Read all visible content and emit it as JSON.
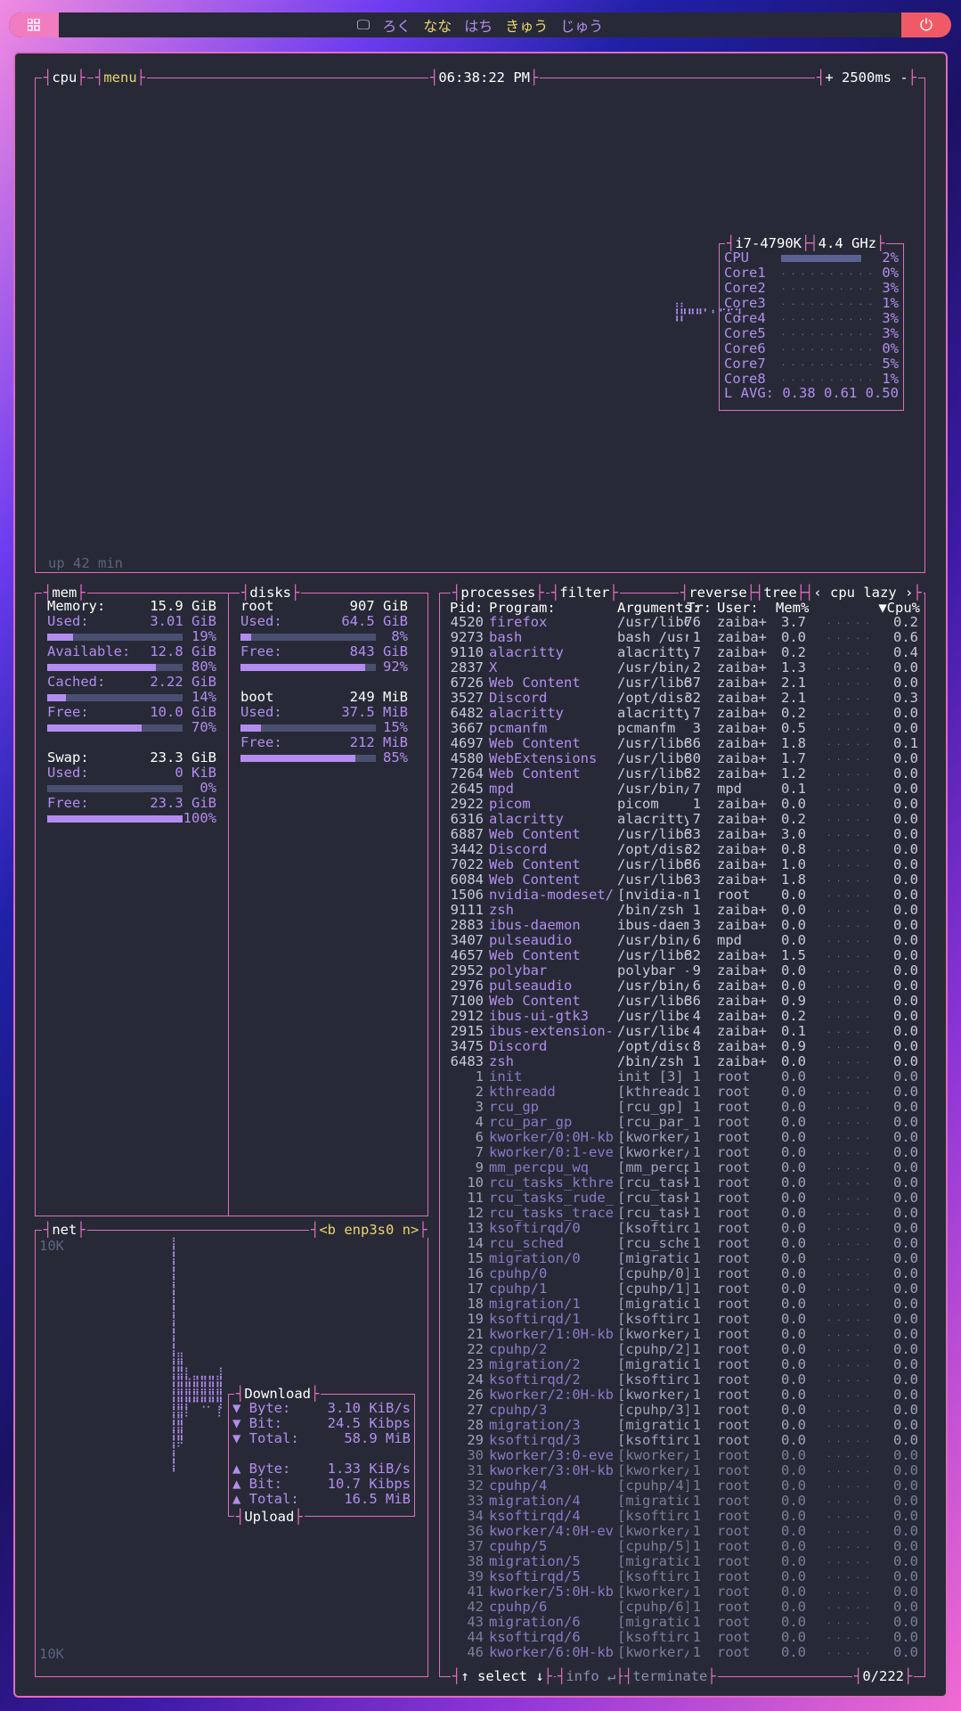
{
  "bar": {
    "workspaces": [
      "ろく",
      "なな",
      "はち",
      "きゅう",
      "じゅう"
    ],
    "active": [
      "なな",
      "きゅう"
    ]
  },
  "cpu": {
    "tab": "cpu",
    "menu": "menu",
    "clock": "06:38:22 PM",
    "refresh": "+ 2500ms -",
    "uptime": "up 42 min",
    "model": "i7-4790K",
    "freq": "4.4 GHz",
    "cores": [
      {
        "label": "CPU",
        "pct": "2%",
        "value": 2
      },
      {
        "label": "Core1",
        "pct": "0%",
        "value": 0
      },
      {
        "label": "Core2",
        "pct": "3%",
        "value": 3
      },
      {
        "label": "Core3",
        "pct": "1%",
        "value": 1
      },
      {
        "label": "Core4",
        "pct": "3%",
        "value": 3
      },
      {
        "label": "Core5",
        "pct": "3%",
        "value": 3
      },
      {
        "label": "Core6",
        "pct": "0%",
        "value": 0
      },
      {
        "label": "Core7",
        "pct": "5%",
        "value": 5
      },
      {
        "label": "Core8",
        "pct": "1%",
        "value": 1
      }
    ],
    "lavg": "L AVG: 0.38 0.61 0.50"
  },
  "mem": {
    "title": "mem",
    "rows": [
      {
        "label": "Memory:",
        "value": "15.9 GiB"
      },
      {
        "label": "Used:",
        "value": "3.01 GiB",
        "pct": "19%",
        "fill": 19
      },
      {
        "label": "Available:",
        "value": "12.8 GiB",
        "pct": "80%",
        "fill": 80
      },
      {
        "label": "Cached:",
        "value": "2.22 GiB",
        "pct": "14%",
        "fill": 14
      },
      {
        "label": "Free:",
        "value": "10.0 GiB",
        "pct": "70%",
        "fill": 70
      },
      {
        "label": "Swap:",
        "value": "23.3 GiB"
      },
      {
        "label": "Used:",
        "value": "0 KiB",
        "pct": "0%",
        "fill": 0
      },
      {
        "label": "Free:",
        "value": "23.3 GiB",
        "pct": "100%",
        "fill": 100
      }
    ]
  },
  "disks": {
    "title": "disks",
    "list": [
      {
        "name": "root",
        "size": "907 GiB",
        "used": "64.5 GiB",
        "used_pct": "8%",
        "used_fill": 8,
        "free": "843 GiB",
        "free_pct": "92%",
        "free_fill": 92
      },
      {
        "name": "boot",
        "size": "249 MiB",
        "used": "37.5 MiB",
        "used_pct": "15%",
        "used_fill": 15,
        "free": "212 MiB",
        "free_pct": "85%",
        "free_fill": 85
      }
    ],
    "used_label": "Used:",
    "free_label": "Free:"
  },
  "net": {
    "title": "net",
    "iface": "<b enp3s0 n>",
    "top_scale": "10K",
    "bottom_scale": "10K",
    "download": {
      "title": "Download",
      "byte": "3.10 KiB/s",
      "bit": "24.5 Kibps",
      "total": "58.9 MiB"
    },
    "upload": {
      "title": "Upload",
      "byte": "1.33 KiB/s",
      "bit": "10.7 Kibps",
      "total": "16.5 MiB"
    },
    "labels": {
      "byte": "Byte:",
      "bit": "Bit:",
      "total": "Total:"
    }
  },
  "proc": {
    "title": "processes",
    "filter": "filter",
    "reverse": "reverse",
    "tree": "tree",
    "sort": "‹ cpu lazy ›",
    "headers": {
      "pid": "Pid:",
      "program": "Program:",
      "args": "Arguments:",
      "threads": "Tr:",
      "user": "User:",
      "mem": "Mem%",
      "cpu": "▼Cpu%"
    },
    "footer": {
      "select": "↑ select ↓",
      "info": "info ↵",
      "terminate": "terminate",
      "count": "0/222"
    },
    "rows": [
      [
        "4520",
        "firefox",
        "/usr/lib6",
        "76",
        "zaiba+",
        "3.7",
        "0.2"
      ],
      [
        "9273",
        "bash",
        "bash /usr",
        "1",
        "zaiba+",
        "0.0",
        "0.6"
      ],
      [
        "9110",
        "alacritty",
        "alacritty",
        "7",
        "zaiba+",
        "0.2",
        "0.4"
      ],
      [
        "2837",
        "X",
        "/usr/bin/",
        "2",
        "zaiba+",
        "1.3",
        "0.0"
      ],
      [
        "6726",
        "Web Content",
        "/usr/lib6",
        "37",
        "zaiba+",
        "2.1",
        "0.0"
      ],
      [
        "3527",
        "Discord",
        "/opt/disc",
        "32",
        "zaiba+",
        "2.1",
        "0.3"
      ],
      [
        "6482",
        "alacritty",
        "alacritty",
        "7",
        "zaiba+",
        "0.2",
        "0.0"
      ],
      [
        "3667",
        "pcmanfm",
        "pcmanfm",
        "3",
        "zaiba+",
        "0.5",
        "0.0"
      ],
      [
        "4697",
        "Web Content",
        "/usr/lib6",
        "36",
        "zaiba+",
        "1.8",
        "0.1"
      ],
      [
        "4580",
        "WebExtensions",
        "/usr/lib6",
        "30",
        "zaiba+",
        "1.7",
        "0.0"
      ],
      [
        "7264",
        "Web Content",
        "/usr/lib6",
        "32",
        "zaiba+",
        "1.2",
        "0.0"
      ],
      [
        "2645",
        "mpd",
        "/usr/bin/",
        "7",
        "mpd",
        "0.1",
        "0.0"
      ],
      [
        "2922",
        "picom",
        "picom",
        "1",
        "zaiba+",
        "0.0",
        "0.0"
      ],
      [
        "6316",
        "alacritty",
        "alacritty",
        "7",
        "zaiba+",
        "0.2",
        "0.0"
      ],
      [
        "6887",
        "Web Content",
        "/usr/lib6",
        "33",
        "zaiba+",
        "3.0",
        "0.0"
      ],
      [
        "3442",
        "Discord",
        "/opt/disc",
        "32",
        "zaiba+",
        "0.8",
        "0.0"
      ],
      [
        "7022",
        "Web Content",
        "/usr/lib6",
        "36",
        "zaiba+",
        "1.0",
        "0.0"
      ],
      [
        "6084",
        "Web Content",
        "/usr/lib6",
        "33",
        "zaiba+",
        "1.8",
        "0.0"
      ],
      [
        "1506",
        "nvidia-modeset/",
        "[nvidia-m",
        "1",
        "root",
        "0.0",
        "0.0"
      ],
      [
        "9111",
        "zsh",
        "/bin/zsh",
        "1",
        "zaiba+",
        "0.0",
        "0.0"
      ],
      [
        "2883",
        "ibus-daemon",
        "ibus-daem",
        "3",
        "zaiba+",
        "0.0",
        "0.0"
      ],
      [
        "3407",
        "pulseaudio",
        "/usr/bin/",
        "6",
        "mpd",
        "0.0",
        "0.0"
      ],
      [
        "4657",
        "Web Content",
        "/usr/lib6",
        "32",
        "zaiba+",
        "1.5",
        "0.0"
      ],
      [
        "2952",
        "polybar",
        "polybar -",
        "9",
        "zaiba+",
        "0.0",
        "0.0"
      ],
      [
        "2976",
        "pulseaudio",
        "/usr/bin/",
        "6",
        "zaiba+",
        "0.0",
        "0.0"
      ],
      [
        "7100",
        "Web Content",
        "/usr/lib6",
        "36",
        "zaiba+",
        "0.9",
        "0.0"
      ],
      [
        "2912",
        "ibus-ui-gtk3",
        "/usr/libe",
        "4",
        "zaiba+",
        "0.2",
        "0.0"
      ],
      [
        "2915",
        "ibus-extension-",
        "/usr/libe",
        "4",
        "zaiba+",
        "0.1",
        "0.0"
      ],
      [
        "3475",
        "Discord",
        "/opt/disc",
        "8",
        "zaiba+",
        "0.9",
        "0.0"
      ],
      [
        "6483",
        "zsh",
        "/bin/zsh",
        "1",
        "zaiba+",
        "0.0",
        "0.0"
      ],
      [
        "1",
        "init",
        "init [3]",
        "1",
        "root",
        "0.0",
        "0.0"
      ],
      [
        "2",
        "kthreadd",
        "[kthreadd",
        "1",
        "root",
        "0.0",
        "0.0"
      ],
      [
        "3",
        "rcu_gp",
        "[rcu_gp]",
        "1",
        "root",
        "0.0",
        "0.0"
      ],
      [
        "4",
        "rcu_par_gp",
        "[rcu_par_",
        "1",
        "root",
        "0.0",
        "0.0"
      ],
      [
        "6",
        "kworker/0:0H-kb",
        "[kworker/",
        "1",
        "root",
        "0.0",
        "0.0"
      ],
      [
        "7",
        "kworker/0:1-eve",
        "[kworker/",
        "1",
        "root",
        "0.0",
        "0.0"
      ],
      [
        "9",
        "mm_percpu_wq",
        "[mm_percp",
        "1",
        "root",
        "0.0",
        "0.0"
      ],
      [
        "10",
        "rcu_tasks_kthre",
        "[rcu_task",
        "1",
        "root",
        "0.0",
        "0.0"
      ],
      [
        "11",
        "rcu_tasks_rude_",
        "[rcu_task",
        "1",
        "root",
        "0.0",
        "0.0"
      ],
      [
        "12",
        "rcu_tasks_trace",
        "[rcu_task",
        "1",
        "root",
        "0.0",
        "0.0"
      ],
      [
        "13",
        "ksoftirqd/0",
        "[ksoftirq",
        "1",
        "root",
        "0.0",
        "0.0"
      ],
      [
        "14",
        "rcu_sched",
        "[rcu_sche",
        "1",
        "root",
        "0.0",
        "0.0"
      ],
      [
        "15",
        "migration/0",
        "[migratio",
        "1",
        "root",
        "0.0",
        "0.0"
      ],
      [
        "16",
        "cpuhp/0",
        "[cpuhp/0]",
        "1",
        "root",
        "0.0",
        "0.0"
      ],
      [
        "17",
        "cpuhp/1",
        "[cpuhp/1]",
        "1",
        "root",
        "0.0",
        "0.0"
      ],
      [
        "18",
        "migration/1",
        "[migratio",
        "1",
        "root",
        "0.0",
        "0.0"
      ],
      [
        "19",
        "ksoftirqd/1",
        "[ksoftirq",
        "1",
        "root",
        "0.0",
        "0.0"
      ],
      [
        "21",
        "kworker/1:0H-kb",
        "[kworker/",
        "1",
        "root",
        "0.0",
        "0.0"
      ],
      [
        "22",
        "cpuhp/2",
        "[cpuhp/2]",
        "1",
        "root",
        "0.0",
        "0.0"
      ],
      [
        "23",
        "migration/2",
        "[migratio",
        "1",
        "root",
        "0.0",
        "0.0"
      ],
      [
        "24",
        "ksoftirqd/2",
        "[ksoftirq",
        "1",
        "root",
        "0.0",
        "0.0"
      ],
      [
        "26",
        "kworker/2:0H-kb",
        "[kworker/",
        "1",
        "root",
        "0.0",
        "0.0"
      ],
      [
        "27",
        "cpuhp/3",
        "[cpuhp/3]",
        "1",
        "root",
        "0.0",
        "0.0"
      ],
      [
        "28",
        "migration/3",
        "[migratio",
        "1",
        "root",
        "0.0",
        "0.0"
      ],
      [
        "29",
        "ksoftirqd/3",
        "[ksoftirq",
        "1",
        "root",
        "0.0",
        "0.0"
      ],
      [
        "30",
        "kworker/3:0-eve",
        "[kworker/",
        "1",
        "root",
        "0.0",
        "0.0"
      ],
      [
        "31",
        "kworker/3:0H-kb",
        "[kworker/",
        "1",
        "root",
        "0.0",
        "0.0"
      ],
      [
        "32",
        "cpuhp/4",
        "[cpuhp/4]",
        "1",
        "root",
        "0.0",
        "0.0"
      ],
      [
        "33",
        "migration/4",
        "[migratio",
        "1",
        "root",
        "0.0",
        "0.0"
      ],
      [
        "34",
        "ksoftirqd/4",
        "[ksoftirq",
        "1",
        "root",
        "0.0",
        "0.0"
      ],
      [
        "36",
        "kworker/4:0H-ev",
        "[kworker/",
        "1",
        "root",
        "0.0",
        "0.0"
      ],
      [
        "37",
        "cpuhp/5",
        "[cpuhp/5]",
        "1",
        "root",
        "0.0",
        "0.0"
      ],
      [
        "38",
        "migration/5",
        "[migratio",
        "1",
        "root",
        "0.0",
        "0.0"
      ],
      [
        "39",
        "ksoftirqd/5",
        "[ksoftirq",
        "1",
        "root",
        "0.0",
        "0.0"
      ],
      [
        "41",
        "kworker/5:0H-kb",
        "[kworker/",
        "1",
        "root",
        "0.0",
        "0.0"
      ],
      [
        "42",
        "cpuhp/6",
        "[cpuhp/6]",
        "1",
        "root",
        "0.0",
        "0.0"
      ],
      [
        "43",
        "migration/6",
        "[migratio",
        "1",
        "root",
        "0.0",
        "0.0"
      ],
      [
        "44",
        "ksoftirqd/6",
        "[ksoftirq",
        "1",
        "root",
        "0.0",
        "0.0"
      ],
      [
        "46",
        "kworker/6:0H-kb",
        "[kworker/",
        "1",
        "root",
        "0.0",
        "0.0"
      ]
    ]
  }
}
